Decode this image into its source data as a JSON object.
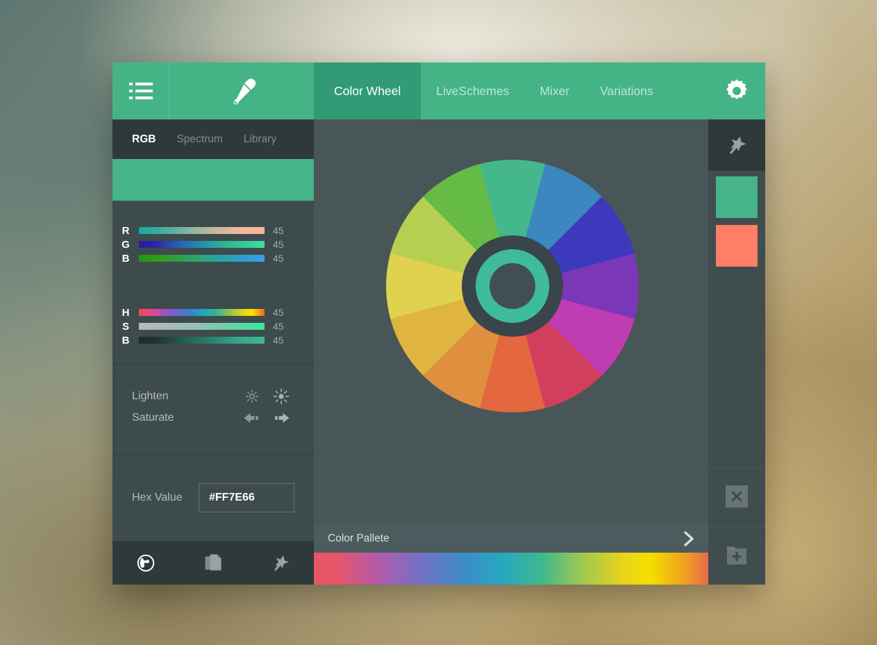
{
  "app": {
    "accent": "#44b487",
    "accent_active": "#329b76",
    "panel_dark": "#3d4b4c",
    "panel_darker": "#2e393a",
    "panel_mid": "#495657"
  },
  "topbar": {
    "menu_icon": "list-menu-icon",
    "eyedropper_icon": "eyedropper-icon",
    "gear_icon": "gear-icon",
    "tabs": [
      {
        "label": "Color Wheel",
        "active": true
      },
      {
        "label": "LiveSchemes",
        "active": false
      },
      {
        "label": "Mixer",
        "active": false
      },
      {
        "label": "Variations",
        "active": false
      }
    ]
  },
  "left_panel": {
    "subtabs": [
      {
        "label": "RGB",
        "active": true
      },
      {
        "label": "Spectrum",
        "active": false
      },
      {
        "label": "Library",
        "active": false
      }
    ],
    "preview_color": "#45b488",
    "rgb": {
      "rows": [
        {
          "label": "R",
          "value": "45",
          "gradient": "linear-gradient(to right, #16a8a0 0%, #39ada0 16%, #93b6a0 44%, #c9b7a0 62%, #eebb9c 80%, #f6b495 100%)"
        },
        {
          "label": "G",
          "value": "45",
          "gradient": "linear-gradient(to right, #2b1b9e 0%, #2c23a8 12%, #2566b4 34%, #2290ad 50%, #2fb594 70%, #3ddf9c 100%)"
        },
        {
          "label": "B",
          "value": "45",
          "gradient": "linear-gradient(to right, #2a9412 0%, #309b18 14%, #2fa055 38%, #2aa68f 56%, #2b9ec6 78%, #3aa2e6 100%)"
        }
      ]
    },
    "hsb": {
      "rows": [
        {
          "label": "H",
          "value": "45",
          "gradient": "linear-gradient(to right, #f4465a 0%, #e8478c 10%, #9b52c6 22%, #3f7ad0 38%, #20a3c0 50%, #39b58a 62%, #8cc551 72%, #ded31e 82%, #f7e500 90%, #f4801e 98%, #f05a38 100%)"
        },
        {
          "label": "S",
          "value": "45",
          "gradient": "linear-gradient(to right, #b5bcb8 0%, #acbab7 20%, #97c0b2 44%, #70cfa8 70%, #3ae79c 100%)"
        },
        {
          "label": "B",
          "value": "45",
          "gradient": "linear-gradient(to right, #1b2c2c 0%, #1f3432 14%, #256055 38%, #2c8270 58%, #37a289 78%, #3fba96 100%)"
        }
      ]
    },
    "adjust": [
      {
        "label": "Lighten",
        "icon_left": "sun-small-icon",
        "icon_right": "sun-large-icon"
      },
      {
        "label": "Saturate",
        "icon_left": "arrow-left-icon",
        "icon_right": "arrow-right-icon"
      }
    ],
    "hex": {
      "label": "Hex Value",
      "value": "#FF7E66",
      "placeholder": "#000000"
    },
    "footer_icons": [
      "globe-icon",
      "copy-icon",
      "pin-icon"
    ]
  },
  "center": {
    "wheel": {
      "segment_count": 12,
      "segments": [
        {
          "index": 0,
          "angle_start": -15,
          "color": "#45b78d",
          "name": "spring-green"
        },
        {
          "index": 1,
          "angle_start": 15,
          "color": "#3c87c0",
          "name": "blue"
        },
        {
          "index": 2,
          "angle_start": 45,
          "color": "#3d39bd",
          "name": "indigo"
        },
        {
          "index": 3,
          "angle_start": 75,
          "color": "#7a37b8",
          "name": "violet"
        },
        {
          "index": 4,
          "angle_start": 105,
          "color": "#c03cb2",
          "name": "magenta"
        },
        {
          "index": 5,
          "angle_start": 135,
          "color": "#d23f5c",
          "name": "crimson"
        },
        {
          "index": 6,
          "angle_start": 165,
          "color": "#e4673f",
          "name": "vermilion"
        },
        {
          "index": 7,
          "angle_start": 195,
          "color": "#e08f3e",
          "name": "orange"
        },
        {
          "index": 8,
          "angle_start": 225,
          "color": "#dfb441",
          "name": "amber"
        },
        {
          "index": 9,
          "angle_start": 255,
          "color": "#e0d14f",
          "name": "yellow"
        },
        {
          "index": 10,
          "angle_start": 285,
          "color": "#b7cf50",
          "name": "yellow-green"
        },
        {
          "index": 11,
          "angle_start": 315,
          "color": "#65bb46",
          "name": "green"
        }
      ],
      "hub_ring_color": "#3ebc9a",
      "hub_outer_color": "#39454b",
      "hub_inner_color": "#414e54"
    },
    "palette": {
      "title": "Color Pallete",
      "chevron_icon": "chevron-right-icon",
      "cursor_position_pct": 58
    }
  },
  "right_panel": {
    "pin_icon": "pin-icon",
    "swatches": [
      {
        "color": "#45b488",
        "name": "swatch-green"
      },
      {
        "color": "#ff7e66",
        "name": "swatch-coral"
      }
    ],
    "close_icon": "close-x-icon",
    "add_icon": "add-folder-icon"
  }
}
